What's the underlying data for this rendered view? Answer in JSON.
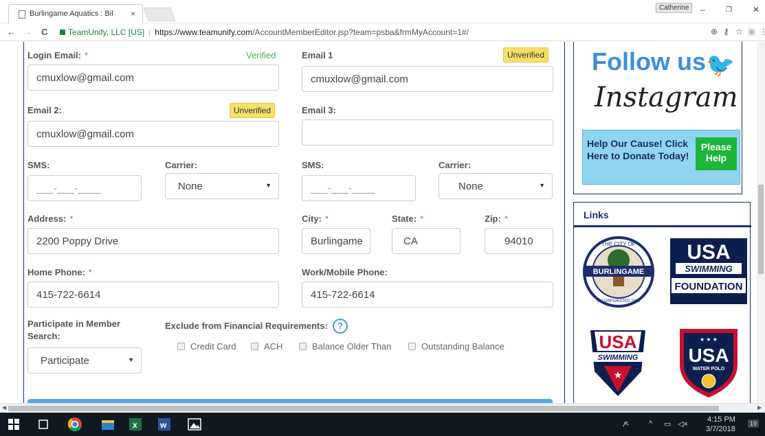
{
  "browser": {
    "tab_title": "Burlingame Aquatics : Bil",
    "tab_close": "×",
    "profile_name": "Catherine",
    "window_min": "–",
    "window_restore": "❐",
    "window_close": "✕",
    "back": "←",
    "forward": "→",
    "reload": "C",
    "security_label": "TeamUnify, LLC [US]",
    "url_host": "https://www.teamunify.com",
    "url_path": "/AccountMemberEditor.jsp?team=psba&frmMyAccount=1#/"
  },
  "form": {
    "login_email_label": "Login Email:",
    "login_email_verified": "Verified",
    "login_email_value": "cmuxlow@gmail.com",
    "email1_label": "Email 1",
    "email1_status": "Unverified",
    "email1_value": "cmuxlow@gmail.com",
    "email2_label": "Email 2:",
    "email2_status": "Unverified",
    "email2_value": "cmuxlow@gmail.com",
    "email3_label": "Email 3:",
    "email3_value": "",
    "sms1_label": "SMS:",
    "sms1_placeholder": "___-___-____",
    "carrier1_label": "Carrier:",
    "carrier1_value": "None",
    "sms2_label": "SMS:",
    "sms2_placeholder": "___-___-____",
    "carrier2_label": "Carrier:",
    "carrier2_value": "None",
    "address_label": "Address:",
    "address_value": "2200 Poppy Drive",
    "city_label": "City:",
    "city_value": "Burlingame",
    "state_label": "State:",
    "state_value": "CA",
    "zip_label": "Zip:",
    "zip_value": "94010",
    "home_phone_label": "Home Phone:",
    "home_phone_value": "415-722-6614",
    "work_phone_label": "Work/Mobile Phone:",
    "work_phone_value": "415-722-6614",
    "participate_label": "Participate in Member Search:",
    "participate_value": "Participate",
    "exclude_label": "Exclude from Financial Requirements:",
    "help_glyph": "?",
    "exclude_options": [
      "Credit Card",
      "ACH",
      "Balance Older Than",
      "Outstanding Balance"
    ],
    "required_mark": "*"
  },
  "sidebar": {
    "follow_text": "Follow us",
    "instagram_text": "Instagram",
    "donate_text": "Help Our Cause! Click Here to Donate Today!",
    "please_help": "Please Help",
    "links_heading": "Links",
    "logo_burlingame_top": "THE CITY OF",
    "logo_burlingame_name": "BURLINGAME",
    "logo_burlingame_bottom": "INCORPORATED 1908",
    "logo_usa_foundation_top": "USA",
    "logo_usa_foundation_mid": "SWIMMING",
    "logo_usa_foundation_bottom": "FOUNDATION",
    "logo_usa_swimming_top": "USA",
    "logo_usa_swimming_bottom": "SWIMMING",
    "logo_usa_waterpolo_top": "USA",
    "logo_usa_waterpolo_bottom": "WATER POLO"
  },
  "taskbar": {
    "time": "4:15 PM",
    "date": "3/7/2018",
    "notifications": "19"
  },
  "colors": {
    "accent_blue": "#3a8fd9",
    "navy": "#1c2e6e",
    "verified_green": "#4caf50",
    "unverified_yellow": "#f5e06b",
    "required_red": "#e05050"
  }
}
